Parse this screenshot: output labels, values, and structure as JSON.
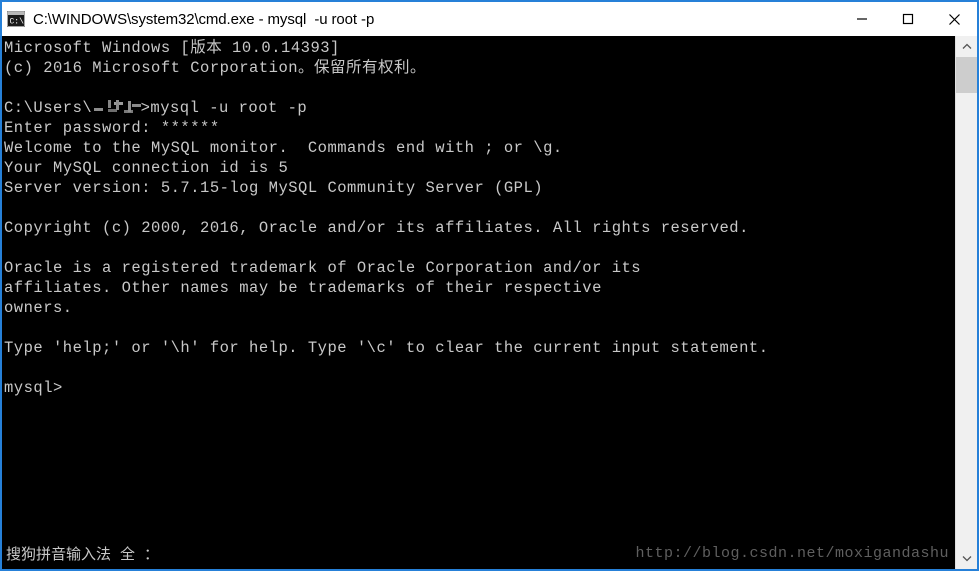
{
  "window": {
    "title": "C:\\WINDOWS\\system32\\cmd.exe - mysql  -u root -p",
    "icon": "cmd-exe-icon",
    "border_color": "#2680d8",
    "titlebar_background": "#ffffff",
    "console_background": "#000000",
    "console_foreground": "#c8c8c8",
    "controls": {
      "minimize": "minimize-icon",
      "maximize": "maximize-icon",
      "close": "close-icon"
    }
  },
  "console": {
    "lines": [
      "Microsoft Windows [版本 10.0.14393]",
      "(c) 2016 Microsoft Corporation。保留所有权利。",
      "",
      "__PROMPT_LINE__",
      "Enter password: ******",
      "Welcome to the MySQL monitor.  Commands end with ; or \\g.",
      "Your MySQL connection id is 5",
      "Server version: 5.7.15-log MySQL Community Server (GPL)",
      "",
      "Copyright (c) 2000, 2016, Oracle and/or its affiliates. All rights reserved.",
      "",
      "Oracle is a registered trademark of Oracle Corporation and/or its",
      "affiliates. Other names may be trademarks of their respective",
      "owners.",
      "",
      "Type 'help;' or '\\h' for help. Type '\\c' to clear the current input statement.",
      "",
      "mysql>"
    ],
    "prompt_line": {
      "prefix": "C:\\Users\\",
      "username": "",
      "suffix": ">",
      "command": "mysql -u root -p"
    }
  },
  "ime": {
    "label": "搜狗拼音输入法 全 ："
  },
  "watermark": {
    "text": "http://blog.csdn.net/moxigandashu"
  },
  "scrollbar": {
    "up_arrow": "chevron-up-icon",
    "down_arrow": "chevron-down-icon",
    "thumb_color": "#cdcdcd",
    "track_color": "#f0f0f0"
  }
}
